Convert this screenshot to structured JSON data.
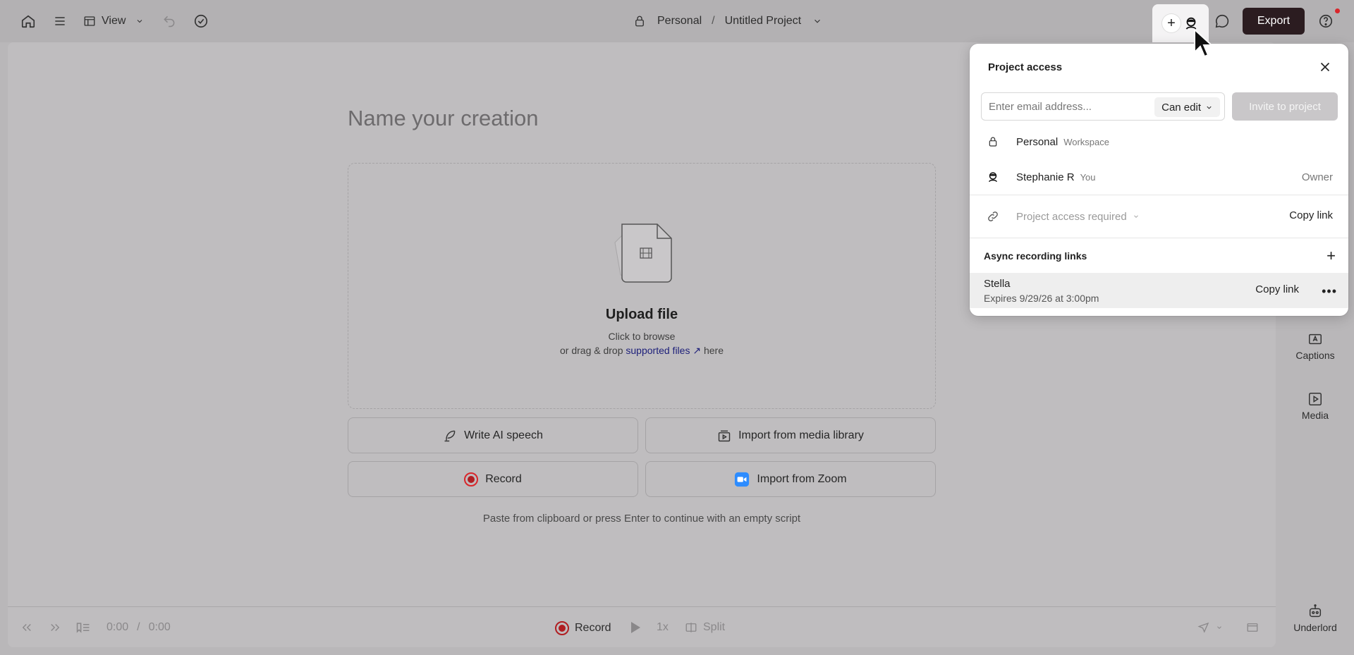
{
  "topbar": {
    "view_label": "View",
    "workspace": "Personal",
    "separator": "/",
    "project_name": "Untitled Project",
    "export_label": "Export"
  },
  "main": {
    "name_placeholder": "Name your creation",
    "upload": {
      "title": "Upload file",
      "line1": "Click to browse",
      "line2_prefix": "or drag & drop",
      "link": "supported files ↗",
      "line2_suffix": "here"
    },
    "actions": {
      "write_ai": "Write AI speech",
      "import_media": "Import from media library",
      "record": "Record",
      "import_zoom": "Import from Zoom"
    },
    "paste_hint": "Paste from clipboard or press Enter to continue with an empty script"
  },
  "bottombar": {
    "time_current": "0:00",
    "time_sep": "/",
    "time_total": "0:00",
    "record_label": "Record",
    "speed": "1x",
    "split_label": "Split"
  },
  "rail": {
    "captions": "Captions",
    "media": "Media",
    "underlord": "Underlord"
  },
  "popover": {
    "title": "Project access",
    "email_placeholder": "Enter email address...",
    "role": "Can edit",
    "invite_label": "Invite to project",
    "members": [
      {
        "name": "Personal",
        "sub": "Workspace",
        "role": ""
      },
      {
        "name": "Stephanie R",
        "sub": "You",
        "role": "Owner"
      }
    ],
    "link_access": "Project access required",
    "copy_link": "Copy link",
    "async_title": "Async recording links",
    "async_links": [
      {
        "name": "Stella",
        "expires": "Expires 9/29/26 at 3:00pm",
        "copy": "Copy link"
      }
    ]
  },
  "colors": {
    "export_bg": "#2b1c20",
    "record_red": "#b01e22",
    "notification_dot": "#d9262b",
    "zoom_blue": "#2d8cff"
  }
}
